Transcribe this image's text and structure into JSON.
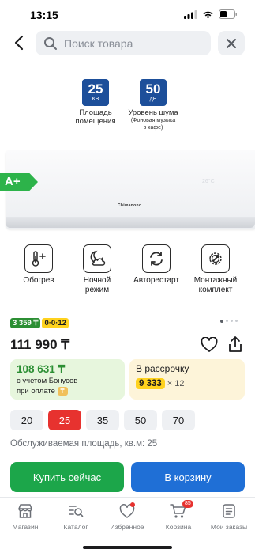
{
  "status_bar": {
    "time": "13:15"
  },
  "search": {
    "placeholder": "Поиск товара"
  },
  "specs": [
    {
      "value": "25",
      "unit": "КВ",
      "label_line1": "Площадь",
      "label_line2": "помещения",
      "sub": ""
    },
    {
      "value": "50",
      "unit": "дБ",
      "label_line1": "Уровень шума",
      "label_line2": "",
      "sub_line1": "(Фоновая музыка",
      "sub_line2": "в кафе)"
    }
  ],
  "product_image": {
    "energy_class": "A+",
    "brand_text": "Chimanono",
    "display": "26°C"
  },
  "features": [
    {
      "label_line1": "Обогрев",
      "label_line2": "",
      "icon": "thermometer-plus-icon"
    },
    {
      "label_line1": "Ночной",
      "label_line2": "режим",
      "icon": "moon-cloud-icon"
    },
    {
      "label_line1": "Авторестарт",
      "label_line2": "",
      "icon": "restart-icon"
    },
    {
      "label_line1": "Монтажный",
      "label_line2": "комплект",
      "icon": "gear-wrench-icon"
    }
  ],
  "bonus": {
    "green_label": "3 359 ₸",
    "yellow_label": "0·0·12"
  },
  "price": "111 990 ₸",
  "bonus_card": {
    "amount": "108 631 ₸",
    "line1": "с учетом Бонусов",
    "line2": "при оплате"
  },
  "installment_card": {
    "title": "В рассрочку",
    "amount": "9 333",
    "months": "× 12"
  },
  "sizes": {
    "options": [
      "20",
      "25",
      "35",
      "50",
      "70"
    ],
    "selected": "25"
  },
  "area_label": "Обслуживаемая площадь, кв.м: 25",
  "buttons": {
    "buy_now": "Купить сейчас",
    "add_to_cart": "В корзину"
  },
  "nav": {
    "items": [
      {
        "label": "Магазин",
        "icon": "store-icon"
      },
      {
        "label": "Каталог",
        "icon": "catalog-search-icon"
      },
      {
        "label": "Избранное",
        "icon": "heart-icon"
      },
      {
        "label": "Корзина",
        "icon": "cart-icon",
        "badge": "85"
      },
      {
        "label": "Мои заказы",
        "icon": "orders-icon"
      }
    ]
  },
  "colors": {
    "accent_red": "#e7322f",
    "green": "#1ca64a",
    "blue": "#1f6fd6",
    "yellow": "#ffd21e",
    "spec_blue": "#1d4f9a"
  }
}
